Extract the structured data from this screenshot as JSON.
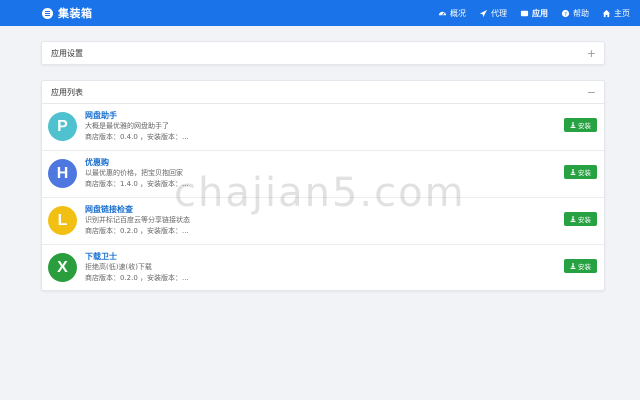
{
  "navbar": {
    "brand": "集装箱",
    "items": [
      {
        "icon": "dashboard-icon",
        "label": "概况",
        "active": false
      },
      {
        "icon": "paper-plane-icon",
        "label": "代理",
        "active": false
      },
      {
        "icon": "window-icon",
        "label": "应用",
        "active": true
      },
      {
        "icon": "question-circle-icon",
        "label": "帮助",
        "active": false
      },
      {
        "icon": "home-icon",
        "label": "主页",
        "active": false
      }
    ]
  },
  "settings_panel": {
    "title": "应用设置",
    "toggle": "+"
  },
  "apps_panel": {
    "title": "应用列表",
    "toggle": "−",
    "apps": [
      {
        "letter": "P",
        "color": "#4fc1cf",
        "name": "网盘助手",
        "desc": "大概是最优雅的网盘助手了",
        "version": "商店版本：0.4.0 ，安装版本：...",
        "button": "安装"
      },
      {
        "letter": "H",
        "color": "#4f77e0",
        "name": "优惠购",
        "desc": "以最优惠的价格，把宝贝抱回家",
        "version": "商店版本：1.4.0 ，安装版本：...",
        "button": "安装"
      },
      {
        "letter": "L",
        "color": "#f1c012",
        "name": "网盘链接检查",
        "desc": "识别并标记百度云等分享链接状态",
        "version": "商店版本：0.2.0 ，安装版本：...",
        "button": "安装"
      },
      {
        "letter": "X",
        "color": "#2a9d3c",
        "name": "下载卫士",
        "desc": "拒绝高(低)速(收)下载",
        "version": "商店版本：0.2.0 ，安装版本：...",
        "button": "安装"
      }
    ]
  },
  "watermark": "chajian5.com"
}
